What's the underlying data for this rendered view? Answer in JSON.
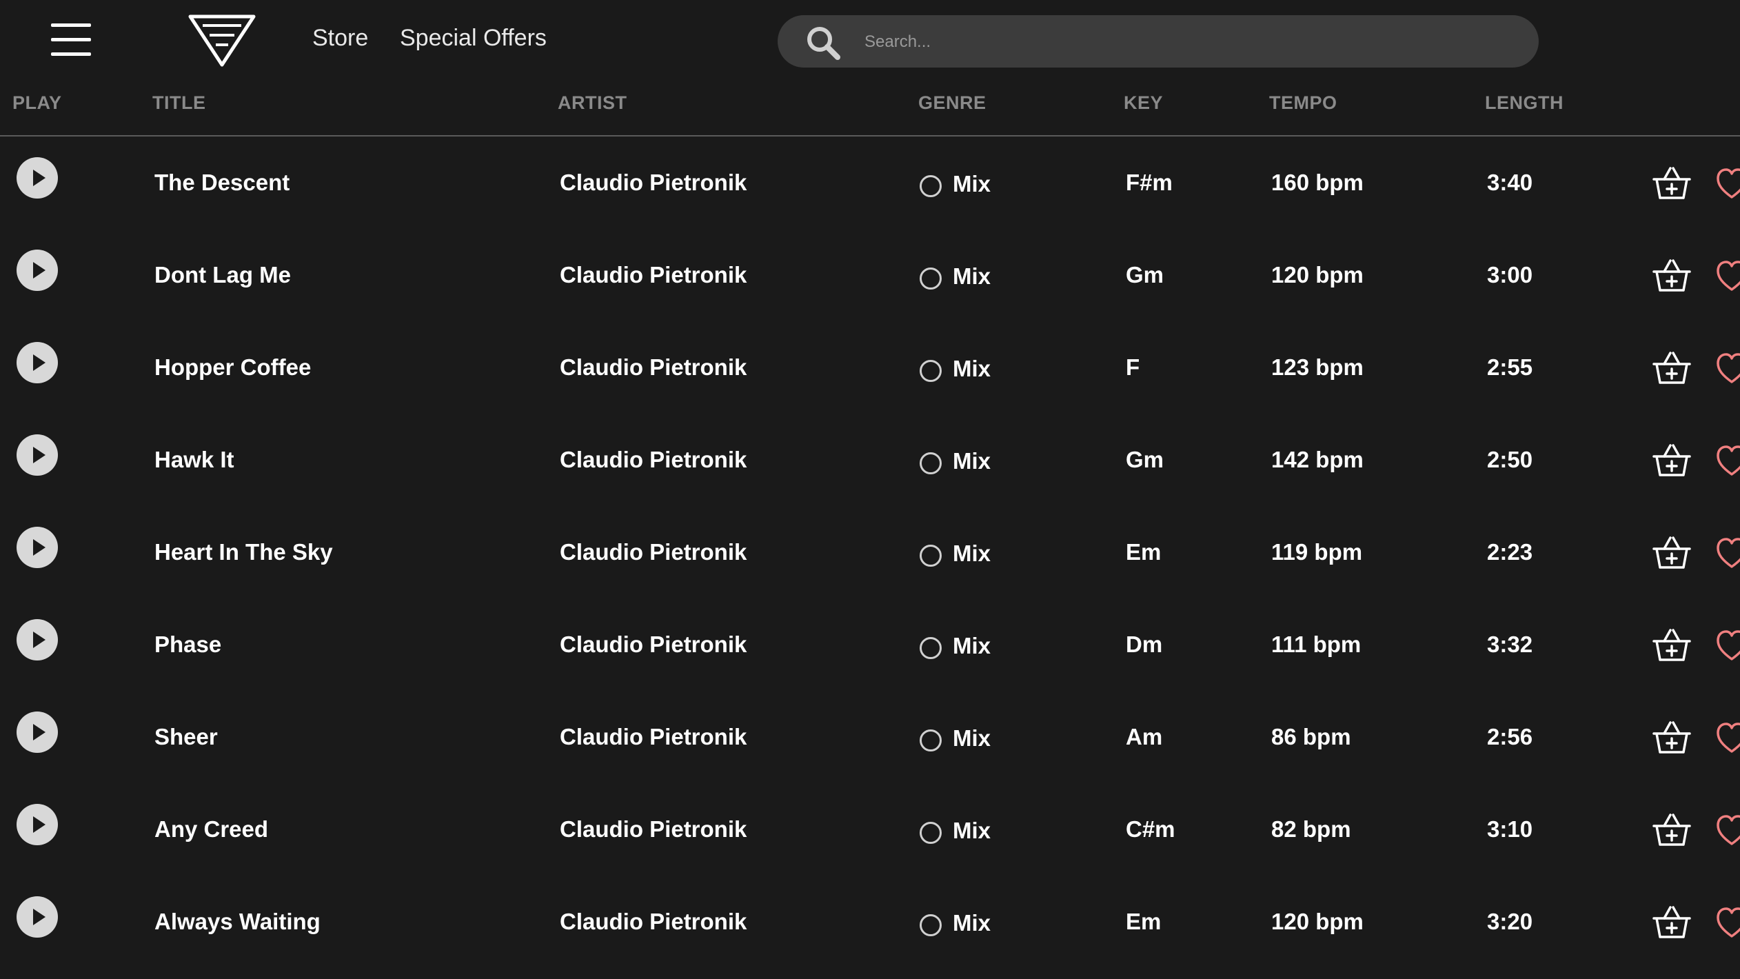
{
  "nav": {
    "store": "Store",
    "special_offers": "Special Offers"
  },
  "search": {
    "placeholder": "Search...",
    "value": ""
  },
  "columns": {
    "play": "PLAY",
    "title": "TITLE",
    "artist": "ARTIST",
    "genre": "GENRE",
    "key": "KEY",
    "tempo": "TEMPO",
    "length": "LENGTH"
  },
  "colors": {
    "background": "#1a1a1a",
    "search_bg": "#3c3c3c",
    "header_text": "#8a8a8a",
    "heart": "#f08080"
  },
  "icons": {
    "menu": "hamburger-icon",
    "logo": "logo-triangle",
    "search": "search-icon",
    "play": "play-icon",
    "genre": "radio-icon",
    "cart": "basket-add-icon",
    "favorite": "heart-icon"
  },
  "tracks": [
    {
      "title": "The Descent",
      "artist": "Claudio Pietronik",
      "genre": "Mix",
      "key": "F#m",
      "tempo": "160 bpm",
      "length": "3:40"
    },
    {
      "title": "Dont Lag Me",
      "artist": "Claudio Pietronik",
      "genre": "Mix",
      "key": "Gm",
      "tempo": "120 bpm",
      "length": "3:00"
    },
    {
      "title": "Hopper Coffee",
      "artist": "Claudio Pietronik",
      "genre": "Mix",
      "key": "F",
      "tempo": "123 bpm",
      "length": "2:55"
    },
    {
      "title": "Hawk It",
      "artist": "Claudio Pietronik",
      "genre": "Mix",
      "key": "Gm",
      "tempo": "142 bpm",
      "length": "2:50"
    },
    {
      "title": "Heart In The Sky",
      "artist": "Claudio Pietronik",
      "genre": "Mix",
      "key": "Em",
      "tempo": "119 bpm",
      "length": "2:23"
    },
    {
      "title": "Phase",
      "artist": "Claudio Pietronik",
      "genre": "Mix",
      "key": "Dm",
      "tempo": "111 bpm",
      "length": "3:32"
    },
    {
      "title": "Sheer",
      "artist": "Claudio Pietronik",
      "genre": "Mix",
      "key": "Am",
      "tempo": "86 bpm",
      "length": "2:56"
    },
    {
      "title": "Any Creed",
      "artist": "Claudio Pietronik",
      "genre": "Mix",
      "key": "C#m",
      "tempo": "82 bpm",
      "length": "3:10"
    },
    {
      "title": "Always Waiting",
      "artist": "Claudio Pietronik",
      "genre": "Mix",
      "key": "Em",
      "tempo": "120 bpm",
      "length": "3:20"
    }
  ]
}
